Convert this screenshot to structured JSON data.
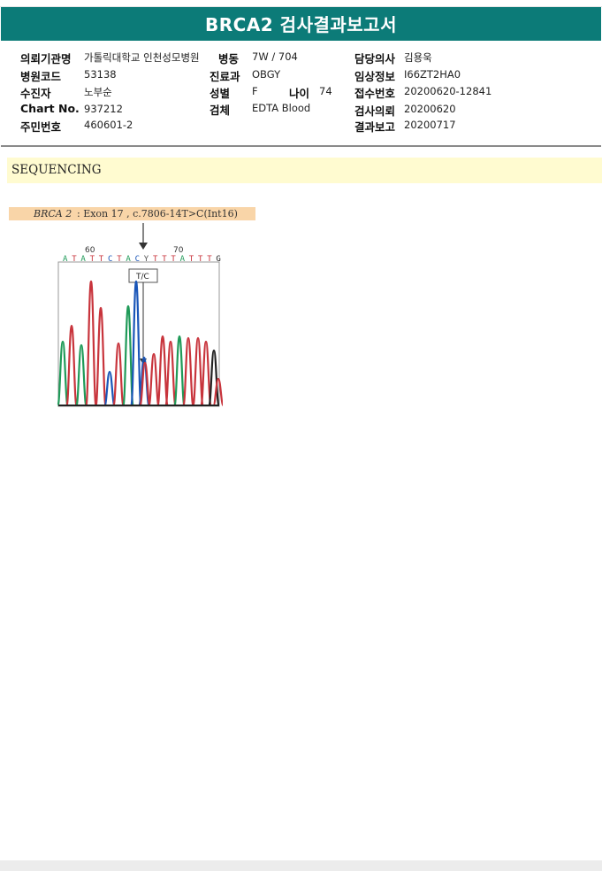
{
  "title": "BRCA2 검사결과보고서",
  "info": {
    "institution_label": "의뢰기관명",
    "institution_value": "가톨릭대학교 인천성모병원",
    "ward_label": "병동",
    "ward_value": "7W / 704",
    "doctor_label": "담당의사",
    "doctor_value": "김용욱",
    "hospital_code_label": "병원코드",
    "hospital_code_value": "53138",
    "dept_label": "진료과",
    "dept_value": "OBGY",
    "clinical_label": "임상정보",
    "clinical_value": "I66ZT2HA0",
    "patient_label": "수진자",
    "patient_value": "노부순",
    "sex_label": "성별",
    "sex_value": "F",
    "age_label": "나이",
    "age_value": "74",
    "receipt_label": "접수번호",
    "receipt_value": "20200620-12841",
    "chart_label": "Chart No.",
    "chart_value": "937212",
    "specimen_label": "검체",
    "specimen_value": "EDTA Blood",
    "request_label": "검사의뢰",
    "request_value": "20200620",
    "id_label": "주민번호",
    "id_value": "460601-2",
    "report_label": "결과보고",
    "report_value": "20200717"
  },
  "section_title": "SEQUENCING",
  "variant": {
    "gene": "BRCA 2",
    "detail": ": Exon 17 , c.7806-14T>C(Int16)"
  },
  "chromatogram": {
    "pos_60": "60",
    "pos_70": "70",
    "bases": [
      "A",
      "T",
      "A",
      "T",
      "T",
      "C",
      "T",
      "A",
      "C",
      "Y",
      "T",
      "T",
      "T",
      "A",
      "T",
      "T",
      "T",
      "G"
    ],
    "callout": "T/C",
    "colors": {
      "A": "#1f9a58",
      "T": "#c8343c",
      "C": "#1a56b8",
      "G": "#222222",
      "Y": "#555555"
    }
  }
}
